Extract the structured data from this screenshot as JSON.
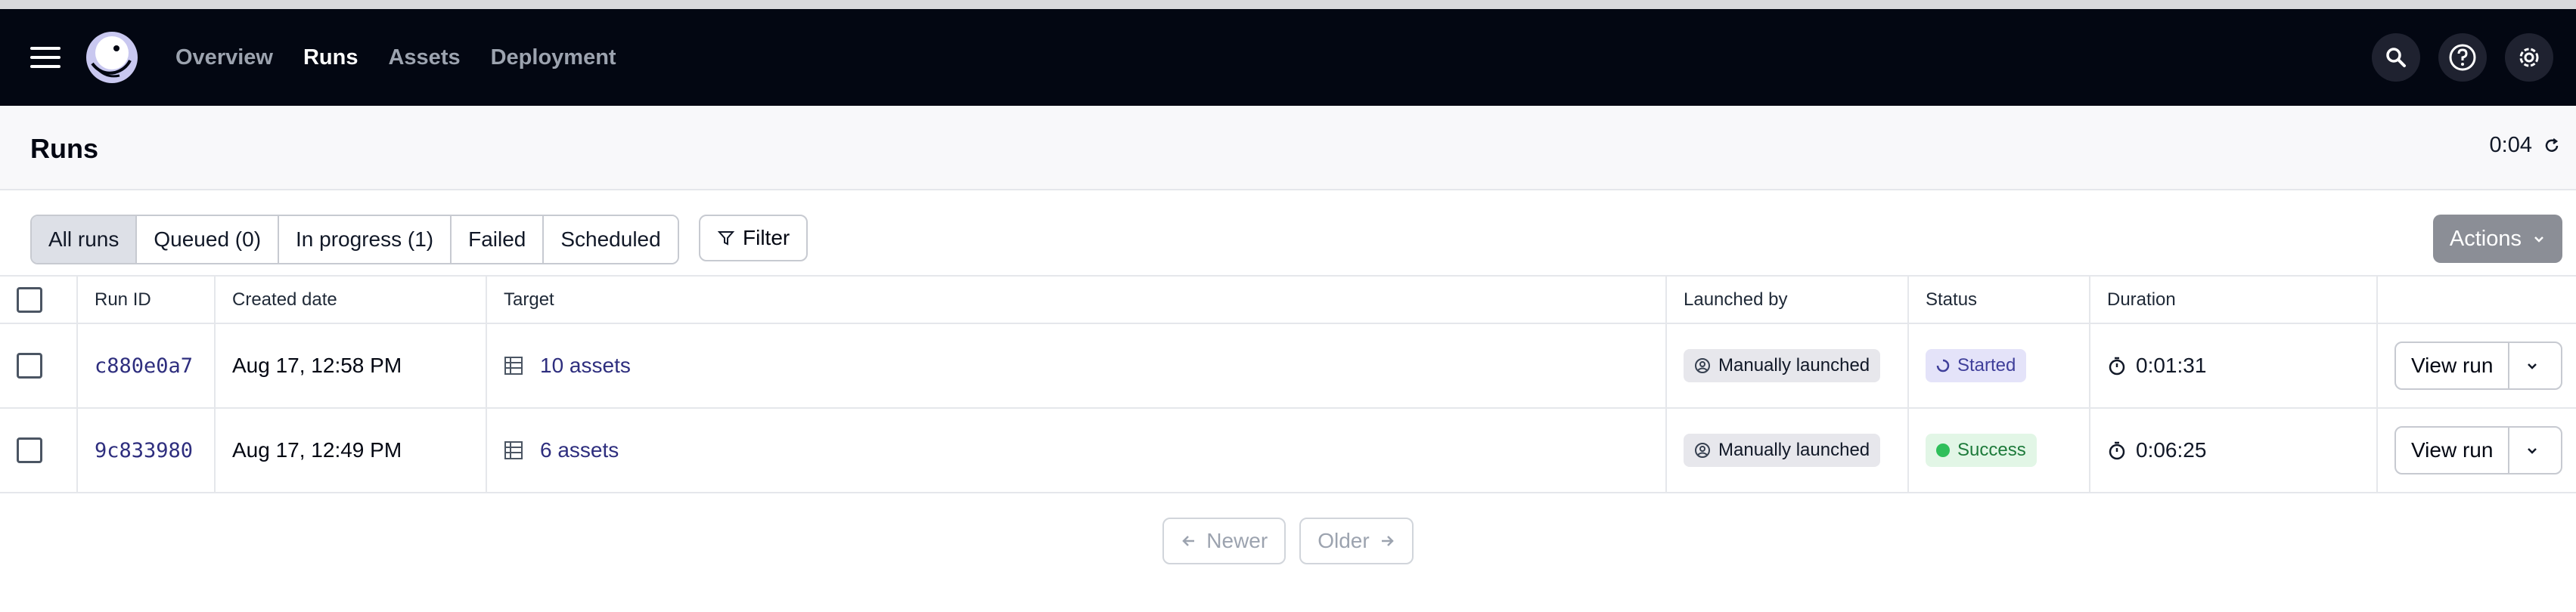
{
  "nav": {
    "links": [
      "Overview",
      "Runs",
      "Assets",
      "Deployment"
    ],
    "active": "Runs",
    "icons": [
      "menu-icon",
      "dagster-logo",
      "search-icon",
      "help-icon",
      "settings-icon"
    ]
  },
  "header": {
    "title": "Runs",
    "refresh_timer": "0:04"
  },
  "toolbar": {
    "tabs": [
      "All runs",
      "Queued (0)",
      "In progress (1)",
      "Failed",
      "Scheduled"
    ],
    "active_tab": "All runs",
    "filter_label": "Filter",
    "actions_label": "Actions"
  },
  "table": {
    "columns": [
      "Run ID",
      "Created date",
      "Target",
      "Launched by",
      "Status",
      "Duration"
    ],
    "rows": [
      {
        "run_id": "c880e0a7",
        "created": "Aug 17, 12:58 PM",
        "target": "10 assets",
        "launched_by": "Manually launched",
        "status": "Started",
        "duration": "0:01:31",
        "action": "View run"
      },
      {
        "run_id": "9c833980",
        "created": "Aug 17, 12:49 PM",
        "target": "6 assets",
        "launched_by": "Manually launched",
        "status": "Success",
        "duration": "0:06:25",
        "action": "View run"
      }
    ]
  },
  "pagination": {
    "newer_label": "Newer",
    "older_label": "Older"
  },
  "colors": {
    "nav_bg": "#030712",
    "link": "#2e2e7e",
    "status_started_bg": "#e4e3f9",
    "status_success_bg": "#e2f6e6",
    "actions_bg": "#8b8e96"
  }
}
